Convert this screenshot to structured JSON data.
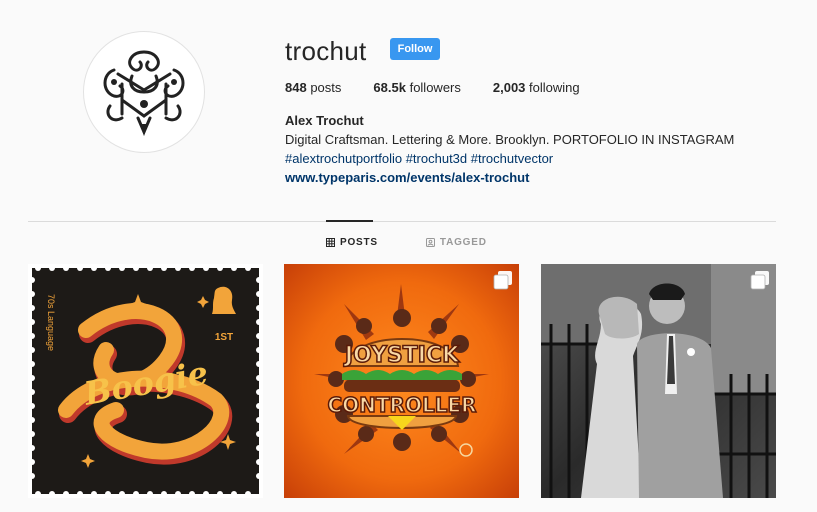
{
  "profile": {
    "username": "trochut",
    "follow_label": "Follow",
    "stats": {
      "posts": "848",
      "posts_label": "posts",
      "followers": "68.5k",
      "followers_label": "followers",
      "following": "2,003",
      "following_label": "following"
    },
    "bio": {
      "full_name": "Alex Trochut",
      "description": "Digital Craftsman. Lettering & More. Brooklyn. PORTOFOLIO IN INSTAGRAM",
      "hashtags": [
        "#alextrochutportfolio",
        "#trochut3d",
        "#trochutvector"
      ],
      "link": "www.typeparis.com/events/alex-trochut"
    }
  },
  "tabs": [
    {
      "label": "POSTS",
      "icon": "grid-icon",
      "active": true
    },
    {
      "label": "TAGGED",
      "icon": "tag-person-icon",
      "active": false
    }
  ],
  "posts": [
    {
      "icon": "stamp-artwork",
      "side_text": "70s Language",
      "value_text": "1ST",
      "lettering": "Boogie"
    },
    {
      "icon": "burger-artwork",
      "lettering_top": "JOYSTICK",
      "lettering_bottom": "CONTROLLER",
      "multi": true
    },
    {
      "icon": "wedding-photo",
      "multi": true
    }
  ],
  "colors": {
    "accent": "#3897f0",
    "link": "#003569",
    "background": "#fafafa",
    "divider": "#dbdbdb"
  }
}
